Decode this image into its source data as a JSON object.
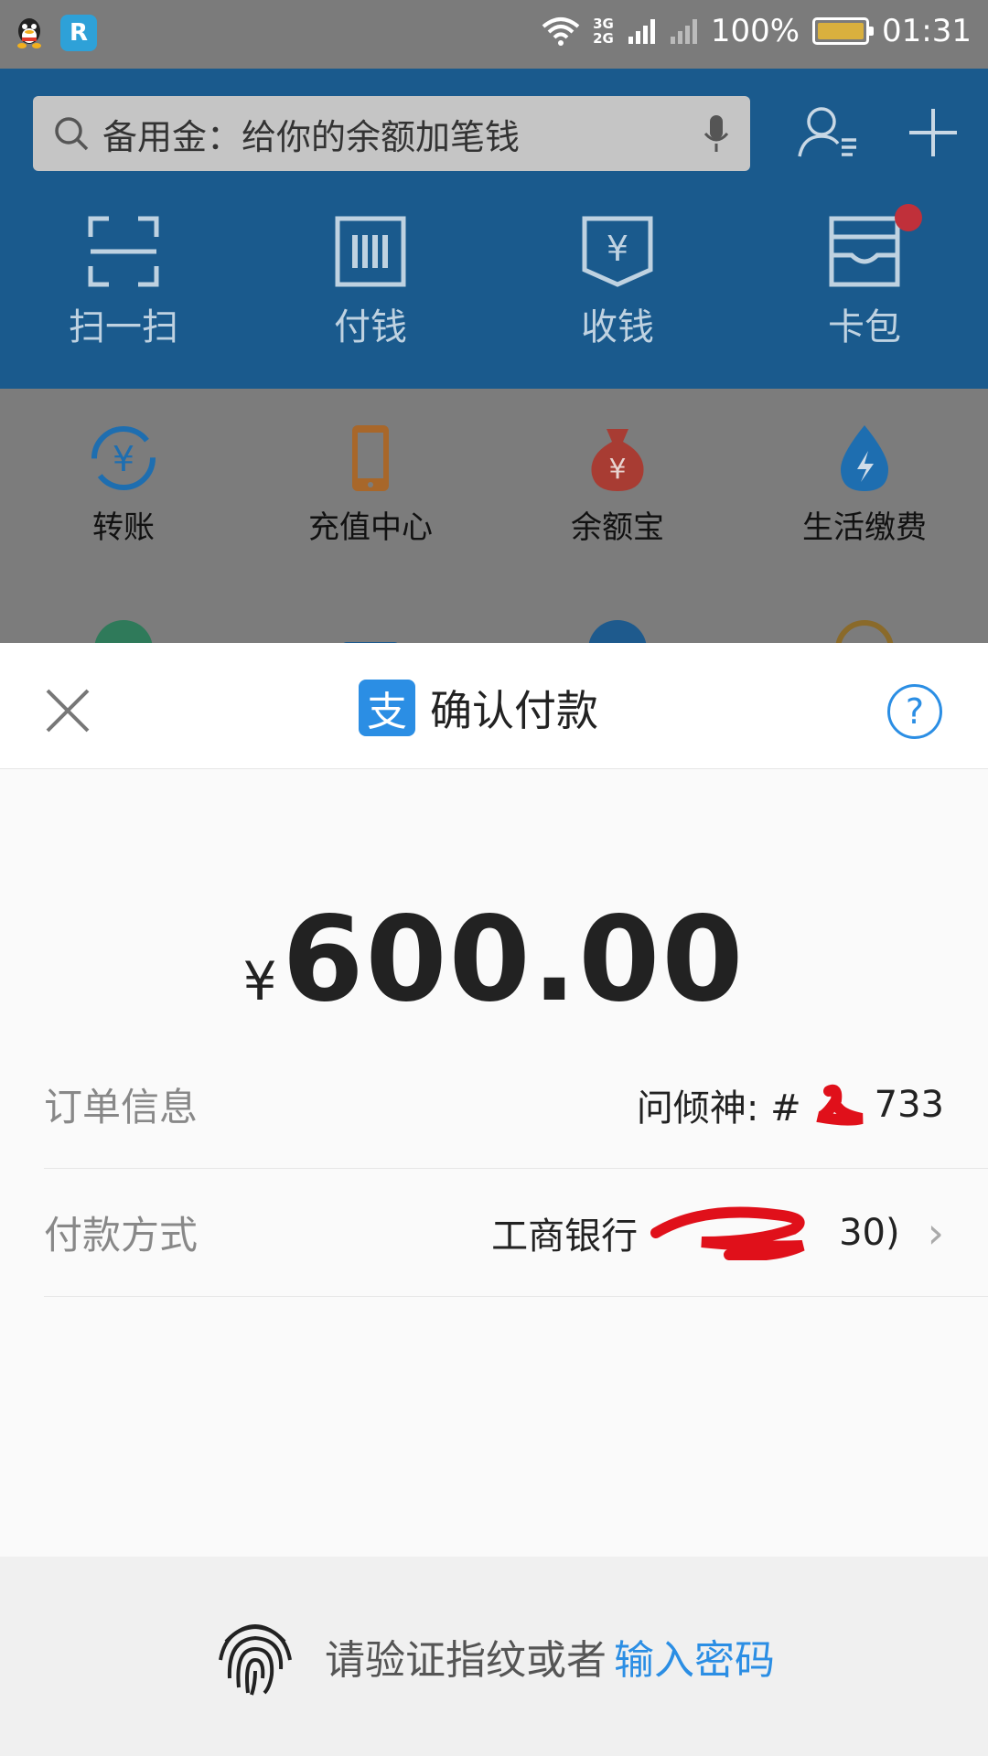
{
  "status_bar": {
    "battery": "100%",
    "time": "01:31",
    "net_top": "3G",
    "net_bottom": "2G",
    "icons": [
      "qq-icon",
      "r-app-icon",
      "wifi-icon",
      "signal-icon",
      "battery-icon"
    ]
  },
  "header": {
    "search_placeholder": "备用金：给你的余额加笔钱",
    "quick_actions": [
      {
        "label": "扫一扫",
        "icon": "scan-icon"
      },
      {
        "label": "付钱",
        "icon": "pay-barcode-icon"
      },
      {
        "label": "收钱",
        "icon": "receive-yen-icon"
      },
      {
        "label": "卡包",
        "icon": "card-pack-icon"
      }
    ]
  },
  "grid": {
    "items": [
      {
        "label": "转账",
        "icon": "transfer-icon",
        "color": "#1e7fd6"
      },
      {
        "label": "充值中心",
        "icon": "phone-recharge-icon",
        "color": "#e58a1f"
      },
      {
        "label": "余额宝",
        "icon": "money-bag-icon",
        "color": "#e04a3a"
      },
      {
        "label": "生活缴费",
        "icon": "utility-drop-icon",
        "color": "#1e7fd6"
      }
    ]
  },
  "sheet": {
    "title": "确认付款",
    "logo_char": "支",
    "help": "?",
    "amount_currency": "¥",
    "amount_value": "600.00",
    "order_label": "订单信息",
    "order_value": "问倾神: #",
    "order_suffix": "733",
    "payment_label": "付款方式",
    "payment_value": "工商银行",
    "payment_suffix": "30)",
    "verify_text": "请验证指纹或者",
    "verify_link": "输入密码"
  },
  "colors": {
    "header_blue": "#1a5a8d",
    "alipay_blue": "#2b8ee4",
    "overlay_gray": "#7c7c7c",
    "redaction_red": "#e0101a"
  }
}
